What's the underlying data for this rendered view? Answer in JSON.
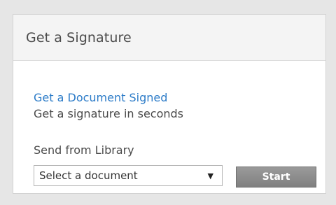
{
  "panel": {
    "title": "Get a Signature"
  },
  "document": {
    "link_label": "Get a Document Signed",
    "subtitle": "Get a signature in seconds"
  },
  "library": {
    "label": "Send from Library",
    "select": {
      "value": "Select a document",
      "arrow_icon": "down-triangle-icon"
    },
    "start_label": "Start"
  },
  "colors": {
    "link": "#2d7cc8",
    "button": "#8c8c8c",
    "header_bg": "#f4f4f4",
    "page_bg": "#e6e6e6"
  }
}
